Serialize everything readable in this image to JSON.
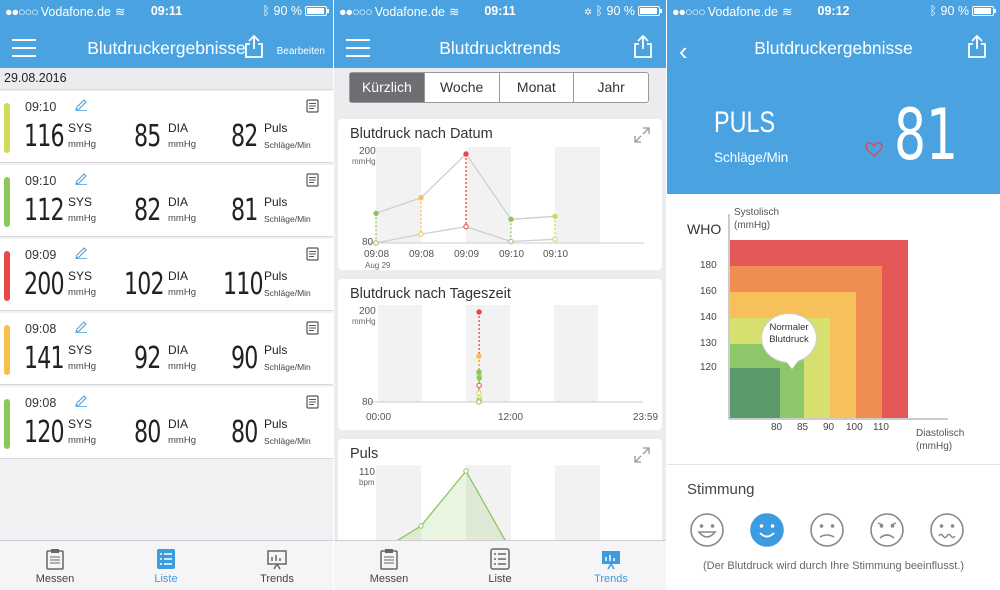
{
  "status": [
    {
      "carrier": "Vodafone.de",
      "time": "09:11",
      "battery": "90 %"
    },
    {
      "carrier": "Vodafone.de",
      "time": "09:11",
      "battery": "90 %"
    },
    {
      "carrier": "Vodafone.de",
      "time": "09:12",
      "battery": "90 %"
    }
  ],
  "list": {
    "title": "Blutdruckergebnisse",
    "edit_label": "Bearbeiten",
    "date": "29.08.2016",
    "entries": [
      {
        "time": "09:10",
        "sys": "116",
        "dia": "85",
        "pulse": "82",
        "color": "#cfd95a"
      },
      {
        "time": "09:10",
        "sys": "112",
        "dia": "82",
        "pulse": "81",
        "color": "#8bc75b"
      },
      {
        "time": "09:09",
        "sys": "200",
        "dia": "102",
        "pulse": "110",
        "color": "#e84747"
      },
      {
        "time": "09:08",
        "sys": "141",
        "dia": "92",
        "pulse": "90",
        "color": "#f5c04c"
      },
      {
        "time": "09:08",
        "sys": "120",
        "dia": "80",
        "pulse": "80",
        "color": "#8bc75b"
      }
    ],
    "labels": {
      "sys": "SYS",
      "dia": "DIA",
      "pulse": "Puls",
      "mmhg": "mmHg",
      "pulse_unit": "Schläge/Min"
    }
  },
  "tabs": [
    {
      "label": "Messen",
      "icon": "clipboard-icon"
    },
    {
      "label": "Liste",
      "icon": "list-icon"
    },
    {
      "label": "Trends",
      "icon": "chart-icon"
    }
  ],
  "trends": {
    "title": "Blutdrucktrends",
    "segments": [
      "Kürzlich",
      "Woche",
      "Monat",
      "Jahr"
    ],
    "selected_segment": "Kürzlich",
    "card1": {
      "title": "Blutdruck nach Datum",
      "ymax": "200",
      "unit": "mmHg",
      "ymin": "80",
      "xlabels": [
        "09:08",
        "09:08",
        "09:09",
        "09:10",
        "09:10"
      ],
      "date": "Aug 29"
    },
    "card2": {
      "title": "Blutdruck nach Tageszeit",
      "ymax": "200",
      "unit": "mmHg",
      "ymin": "80",
      "xlabels": [
        "00:00",
        "12:00",
        "23:59"
      ]
    },
    "card3": {
      "title": "Puls",
      "ymax": "110",
      "unit": "bpm"
    }
  },
  "chart_data": [
    {
      "type": "line",
      "title": "Blutdruck nach Datum",
      "ylabel": "mmHg",
      "ylim": [
        80,
        200
      ],
      "categories": [
        "09:08",
        "09:08",
        "09:09",
        "09:10",
        "09:10"
      ],
      "series": [
        {
          "values": [
            120,
            141,
            200,
            112,
            116
          ]
        },
        {
          "values": [
            80,
            92,
            102,
            82,
            85
          ]
        }
      ],
      "point_colors": [
        "#8bc75b",
        "#f5c04c",
        "#e84747",
        "#8bc75b",
        "#cfd95a"
      ]
    },
    {
      "type": "scatter",
      "title": "Blutdruck nach Tageszeit",
      "ylabel": "mmHg",
      "ylim": [
        80,
        200
      ],
      "xlabels": [
        "00:00",
        "12:00",
        "23:59"
      ],
      "points": [
        {
          "x": "09:10",
          "sys": 116,
          "dia": 85
        },
        {
          "x": "09:10",
          "sys": 112,
          "dia": 82
        },
        {
          "x": "09:09",
          "sys": 200,
          "dia": 102
        },
        {
          "x": "09:08",
          "sys": 141,
          "dia": 92
        },
        {
          "x": "09:08",
          "sys": 120,
          "dia": 80
        }
      ]
    },
    {
      "type": "area",
      "title": "Puls",
      "ylabel": "bpm",
      "ymax": 110,
      "categories": [
        "09:08",
        "09:08",
        "09:09",
        "09:10",
        "09:10"
      ],
      "values": [
        80,
        90,
        110,
        81,
        82
      ]
    },
    {
      "type": "heatmap",
      "title": "WHO",
      "ylabel": "Systolisch (mmHg)",
      "xlabel": "Diastolisch (mmHg)",
      "yticks": [
        "180",
        "160",
        "140",
        "130",
        "120"
      ],
      "xticks": [
        "80",
        "85",
        "90",
        "100",
        "110"
      ],
      "zones": [
        {
          "name": "Normaler Blutdruck",
          "color": "#8bc75b"
        }
      ]
    }
  ],
  "pulse_detail": {
    "title": "Blutdruckergebnisse",
    "label": "PULS",
    "unit": "Schläge/Min",
    "value": "81",
    "who": "WHO",
    "ytitle_1": "Systolisch",
    "ytitle_2": "(mmHg)",
    "xtitle_1": "Diastolisch",
    "xtitle_2": "(mmHg)",
    "bubble_1": "Normaler",
    "bubble_2": "Blutdruck",
    "mood_title": "Stimmung",
    "mood_note": "(Der Blutdruck wird durch Ihre Stimmung beeinflusst.)",
    "moods": [
      "very-happy-face-icon",
      "happy-face-icon",
      "neutral-face-icon",
      "unhappy-face-icon",
      "sick-face-icon"
    ],
    "selected_mood": 1
  }
}
